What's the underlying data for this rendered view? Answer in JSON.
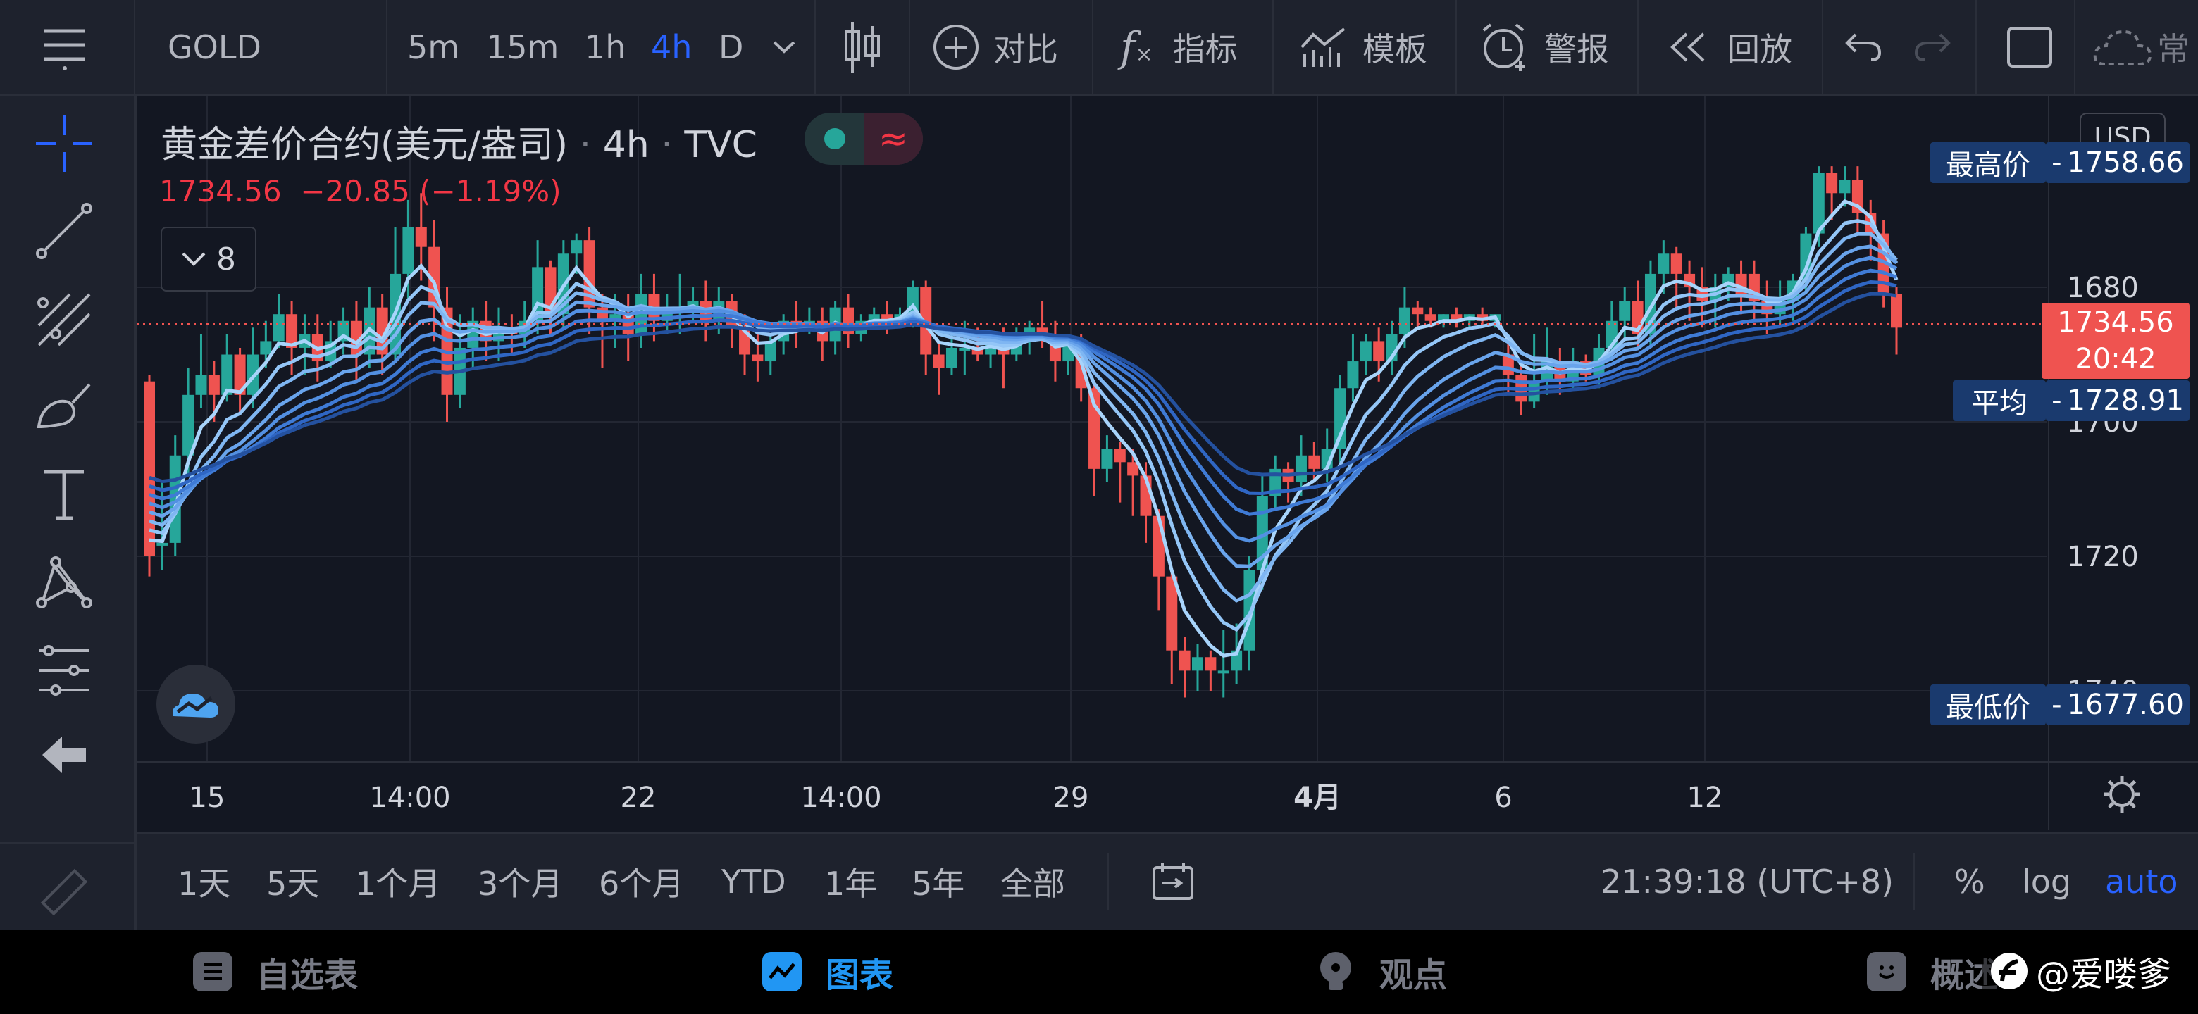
{
  "toolbar": {
    "symbol": "GOLD",
    "intervals": [
      "5m",
      "15m",
      "1h",
      "4h",
      "D"
    ],
    "active_interval": "4h",
    "compare_label": "对比",
    "indicators_label": "指标",
    "templates_label": "模板",
    "alerts_label": "警报",
    "replay_label": "回放",
    "more_label": "常"
  },
  "legend": {
    "title": "黄金差价合约(美元/盎司)",
    "interval": "4h",
    "source": "TVC",
    "last": "1734.56",
    "change": "−20.85",
    "change_pct": "(−1.19%)",
    "indicator_count": "8"
  },
  "price_scale": {
    "currency": "USD",
    "ticks": [
      "1740",
      "1720",
      "1700",
      "1680"
    ],
    "high_label": "最高价",
    "high_value": "1758.66",
    "last_value": "1734.56",
    "countdown": "20:42",
    "avg_label": "平均",
    "avg_value": "1728.91",
    "low_label": "最低价",
    "low_value": "1677.60"
  },
  "time_axis": {
    "labels": [
      "15",
      "14:00",
      "22",
      "14:00",
      "29",
      "4月",
      "6",
      "12"
    ]
  },
  "ranges": [
    "1天",
    "5天",
    "1个月",
    "3个月",
    "6个月",
    "YTD",
    "1年",
    "5年",
    "全部"
  ],
  "clock": "21:39:18 (UTC+8)",
  "scale_options": {
    "percent": "%",
    "log": "log",
    "auto": "auto"
  },
  "nav": {
    "watchlist": "自选表",
    "chart": "图表",
    "ideas": "观点",
    "overview": "概述"
  },
  "watermark": "@爱喽爹",
  "colors": {
    "up": "#26a69a",
    "down": "#ef5350",
    "accent": "#2962ff",
    "ribbon_light": "#90caf9",
    "ribbon_dark": "#1e4fa8"
  },
  "chart_data": {
    "type": "candlestick",
    "ylim": [
      1677.6,
      1758.66
    ],
    "ticks": [
      1680,
      1700,
      1720,
      1740
    ],
    "last": 1734.56,
    "average": 1728.91,
    "candles": [
      [
        1726,
        1700,
        1697,
        1727
      ],
      [
        1702,
        1702,
        1698,
        1711
      ],
      [
        1702,
        1715,
        1700,
        1718
      ],
      [
        1715,
        1724,
        1712,
        1728
      ],
      [
        1724,
        1727,
        1722,
        1733
      ],
      [
        1727,
        1724,
        1720,
        1729
      ],
      [
        1724,
        1730,
        1723,
        1733
      ],
      [
        1730,
        1724,
        1721,
        1731
      ],
      [
        1724,
        1730,
        1722,
        1734
      ],
      [
        1730,
        1732,
        1728,
        1735
      ],
      [
        1732,
        1736,
        1731,
        1739
      ],
      [
        1736,
        1731,
        1727,
        1738
      ],
      [
        1731,
        1733,
        1727,
        1736
      ],
      [
        1733,
        1729,
        1726,
        1736
      ],
      [
        1729,
        1732,
        1728,
        1735
      ],
      [
        1732,
        1735,
        1730,
        1737
      ],
      [
        1735,
        1730,
        1726,
        1738
      ],
      [
        1730,
        1737,
        1728,
        1740
      ],
      [
        1737,
        1730,
        1727,
        1739
      ],
      [
        1730,
        1742,
        1729,
        1749
      ],
      [
        1742,
        1749,
        1738,
        1753
      ],
      [
        1749,
        1746,
        1741,
        1754
      ],
      [
        1746,
        1737,
        1732,
        1750
      ],
      [
        1737,
        1724,
        1720,
        1740
      ],
      [
        1724,
        1731,
        1722,
        1736
      ],
      [
        1731,
        1735,
        1728,
        1737
      ],
      [
        1735,
        1732,
        1729,
        1738
      ],
      [
        1732,
        1734,
        1729,
        1737
      ],
      [
        1734,
        1733,
        1730,
        1736
      ],
      [
        1733,
        1735,
        1731,
        1738
      ],
      [
        1735,
        1743,
        1733,
        1747
      ],
      [
        1743,
        1736,
        1733,
        1744
      ],
      [
        1736,
        1745,
        1734,
        1747
      ],
      [
        1745,
        1747,
        1742,
        1748
      ],
      [
        1747,
        1737,
        1733,
        1749
      ],
      [
        1737,
        1735,
        1728,
        1739
      ],
      [
        1735,
        1736,
        1731,
        1739
      ],
      [
        1736,
        1733,
        1729,
        1739
      ],
      [
        1733,
        1739,
        1731,
        1742
      ],
      [
        1739,
        1735,
        1732,
        1742
      ],
      [
        1735,
        1737,
        1733,
        1739
      ],
      [
        1737,
        1737,
        1733,
        1742
      ],
      [
        1737,
        1738,
        1735,
        1740
      ],
      [
        1738,
        1735,
        1732,
        1741
      ],
      [
        1735,
        1738,
        1733,
        1740
      ],
      [
        1738,
        1734,
        1731,
        1739
      ],
      [
        1734,
        1730,
        1727,
        1736
      ],
      [
        1730,
        1729,
        1726,
        1733
      ],
      [
        1729,
        1732,
        1727,
        1733
      ],
      [
        1732,
        1735,
        1730,
        1736
      ],
      [
        1735,
        1734,
        1731,
        1738
      ],
      [
        1734,
        1735,
        1733,
        1737
      ],
      [
        1735,
        1732,
        1729,
        1737
      ],
      [
        1732,
        1737,
        1730,
        1738
      ],
      [
        1737,
        1733,
        1731,
        1739
      ],
      [
        1733,
        1735,
        1732,
        1736
      ],
      [
        1735,
        1736,
        1734,
        1737
      ],
      [
        1736,
        1735,
        1733,
        1738
      ],
      [
        1735,
        1736,
        1734,
        1737
      ],
      [
        1736,
        1740,
        1734,
        1741
      ],
      [
        1740,
        1730,
        1727,
        1741
      ],
      [
        1730,
        1728,
        1724,
        1732
      ],
      [
        1728,
        1731,
        1727,
        1733
      ],
      [
        1731,
        1731,
        1727,
        1735
      ],
      [
        1731,
        1730,
        1729,
        1734
      ],
      [
        1730,
        1732,
        1728,
        1733
      ],
      [
        1732,
        1730,
        1725,
        1734
      ],
      [
        1730,
        1732,
        1729,
        1734
      ],
      [
        1732,
        1734,
        1730,
        1735
      ],
      [
        1734,
        1733,
        1731,
        1738
      ],
      [
        1733,
        1729,
        1726,
        1735
      ],
      [
        1729,
        1732,
        1727,
        1733
      ],
      [
        1732,
        1725,
        1723,
        1733
      ],
      [
        1725,
        1713,
        1709,
        1726
      ],
      [
        1713,
        1716,
        1711,
        1718
      ],
      [
        1716,
        1714,
        1708,
        1717
      ],
      [
        1714,
        1712,
        1706,
        1716
      ],
      [
        1712,
        1706,
        1702,
        1714
      ],
      [
        1706,
        1697,
        1692,
        1707
      ],
      [
        1697,
        1686,
        1681,
        1698
      ],
      [
        1686,
        1683,
        1679,
        1688
      ],
      [
        1683,
        1685,
        1680,
        1687
      ],
      [
        1685,
        1683,
        1680,
        1686
      ],
      [
        1683,
        1683,
        1679,
        1689
      ],
      [
        1683,
        1686,
        1681,
        1690
      ],
      [
        1686,
        1698,
        1683,
        1700
      ],
      [
        1698,
        1709,
        1695,
        1712
      ],
      [
        1709,
        1713,
        1707,
        1715
      ],
      [
        1713,
        1711,
        1708,
        1714
      ],
      [
        1711,
        1715,
        1709,
        1718
      ],
      [
        1715,
        1713,
        1711,
        1717
      ],
      [
        1713,
        1716,
        1711,
        1719
      ],
      [
        1716,
        1725,
        1714,
        1727
      ],
      [
        1725,
        1729,
        1723,
        1733
      ],
      [
        1729,
        1732,
        1727,
        1733
      ],
      [
        1732,
        1729,
        1726,
        1734
      ],
      [
        1729,
        1733,
        1727,
        1735
      ],
      [
        1733,
        1737,
        1731,
        1740
      ],
      [
        1737,
        1736,
        1734,
        1738
      ],
      [
        1736,
        1735,
        1734,
        1737
      ],
      [
        1735,
        1736,
        1734,
        1736
      ],
      [
        1736,
        1735,
        1734,
        1737
      ],
      [
        1735,
        1736,
        1734,
        1736
      ],
      [
        1736,
        1735,
        1734,
        1737
      ],
      [
        1735,
        1736,
        1734,
        1736
      ],
      [
        1730,
        1727,
        1724,
        1732
      ],
      [
        1727,
        1723,
        1721,
        1729
      ],
      [
        1723,
        1726,
        1722,
        1733
      ],
      [
        1726,
        1729,
        1724,
        1734
      ],
      [
        1729,
        1726,
        1724,
        1731
      ],
      [
        1726,
        1729,
        1725,
        1731
      ],
      [
        1729,
        1727,
        1726,
        1730
      ],
      [
        1727,
        1731,
        1725,
        1733
      ],
      [
        1731,
        1735,
        1729,
        1738
      ],
      [
        1735,
        1738,
        1732,
        1740
      ],
      [
        1738,
        1733,
        1731,
        1741
      ],
      [
        1733,
        1742,
        1731,
        1744
      ],
      [
        1742,
        1745,
        1739,
        1747
      ],
      [
        1745,
        1742,
        1737,
        1746
      ],
      [
        1742,
        1740,
        1735,
        1744
      ],
      [
        1740,
        1738,
        1734,
        1743
      ],
      [
        1738,
        1740,
        1734,
        1742
      ],
      [
        1740,
        1742,
        1738,
        1743
      ],
      [
        1742,
        1739,
        1736,
        1744
      ],
      [
        1742,
        1738,
        1735,
        1744
      ],
      [
        1738,
        1736,
        1733,
        1741
      ],
      [
        1736,
        1738,
        1734,
        1741
      ],
      [
        1738,
        1741,
        1735,
        1742
      ],
      [
        1741,
        1748,
        1739,
        1749
      ],
      [
        1748,
        1757,
        1746,
        1758
      ],
      [
        1757,
        1754,
        1750,
        1758
      ],
      [
        1754,
        1756,
        1752,
        1758
      ],
      [
        1756,
        1751,
        1748,
        1758
      ],
      [
        1751,
        1748,
        1744,
        1753
      ],
      [
        1748,
        1739,
        1737,
        1750
      ],
      [
        1739,
        1734,
        1730,
        1740
      ]
    ],
    "ribbon_count": 8
  }
}
